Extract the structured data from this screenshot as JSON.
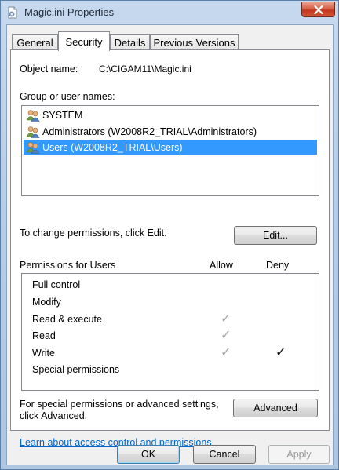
{
  "window": {
    "title": "Magic.ini Properties"
  },
  "tabs": [
    {
      "label": "General",
      "active": false
    },
    {
      "label": "Security",
      "active": true
    },
    {
      "label": "Details",
      "active": false
    },
    {
      "label": "Previous Versions",
      "active": false
    }
  ],
  "security": {
    "object_label": "Object name:",
    "object_value": "C:\\CIGAM11\\Magic.ini",
    "group_label": "Group or user names:",
    "groups": [
      {
        "name": "SYSTEM",
        "selected": false
      },
      {
        "name": "Administrators (W2008R2_TRIAL\\Administrators)",
        "selected": false
      },
      {
        "name": "Users (W2008R2_TRIAL\\Users)",
        "selected": true
      }
    ],
    "change_text": "To change permissions, click Edit.",
    "edit_button": "Edit...",
    "permissions_label": "Permissions for Users",
    "allow_header": "Allow",
    "deny_header": "Deny",
    "permissions": [
      {
        "name": "Full control",
        "allow": "",
        "deny": ""
      },
      {
        "name": "Modify",
        "allow": "",
        "deny": ""
      },
      {
        "name": "Read & execute",
        "allow": "✓",
        "deny": ""
      },
      {
        "name": "Read",
        "allow": "✓",
        "deny": ""
      },
      {
        "name": "Write",
        "allow": "✓",
        "deny": "✓"
      },
      {
        "name": "Special permissions",
        "allow": "",
        "deny": ""
      }
    ],
    "advanced_text_1": "For special permissions or advanced settings,",
    "advanced_text_2": "click Advanced.",
    "advanced_button": "Advanced",
    "learn_link": "Learn about access control and permissions"
  },
  "footer": {
    "ok": "OK",
    "cancel": "Cancel",
    "apply": "Apply"
  },
  "colors": {
    "selection": "#3399ff",
    "link": "#0066cc",
    "close_button": "#c2381c"
  },
  "icons": {
    "title": "ini-file-icon",
    "close": "close-icon",
    "user_group": "user-group-icon"
  }
}
